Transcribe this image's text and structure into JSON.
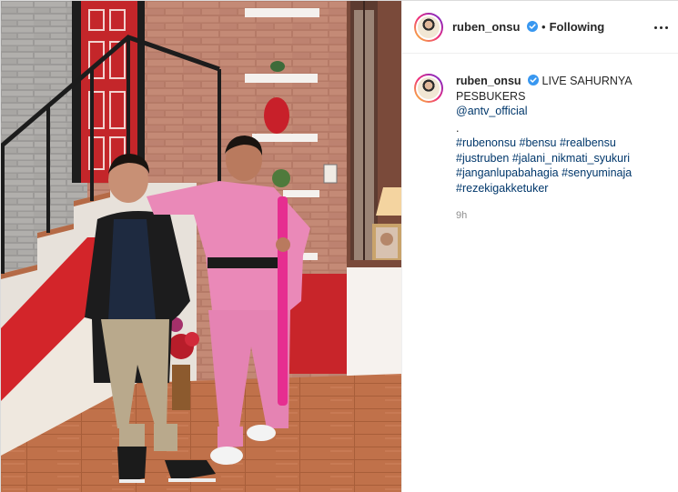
{
  "post": {
    "username": "ruben_onsu",
    "separator": "•",
    "follow_status": "Following"
  },
  "caption": {
    "username": "ruben_onsu",
    "text": "LIVE SAHURNYA PESBUKERS",
    "mention": "@antv_official",
    "dot": ".",
    "hashtags": "#rubenonsu #bensu #realbensu #justruben #jalani_nikmati_syukuri #janganlupabahagia #senyuminaja #rezekigakketuker",
    "timestamp": "9h"
  },
  "icons": {
    "verified": "verified-badge-icon",
    "more": "more-options-icon"
  },
  "colors": {
    "link": "#00376b",
    "verified": "#3897f0",
    "muted": "#8e8e8e"
  }
}
